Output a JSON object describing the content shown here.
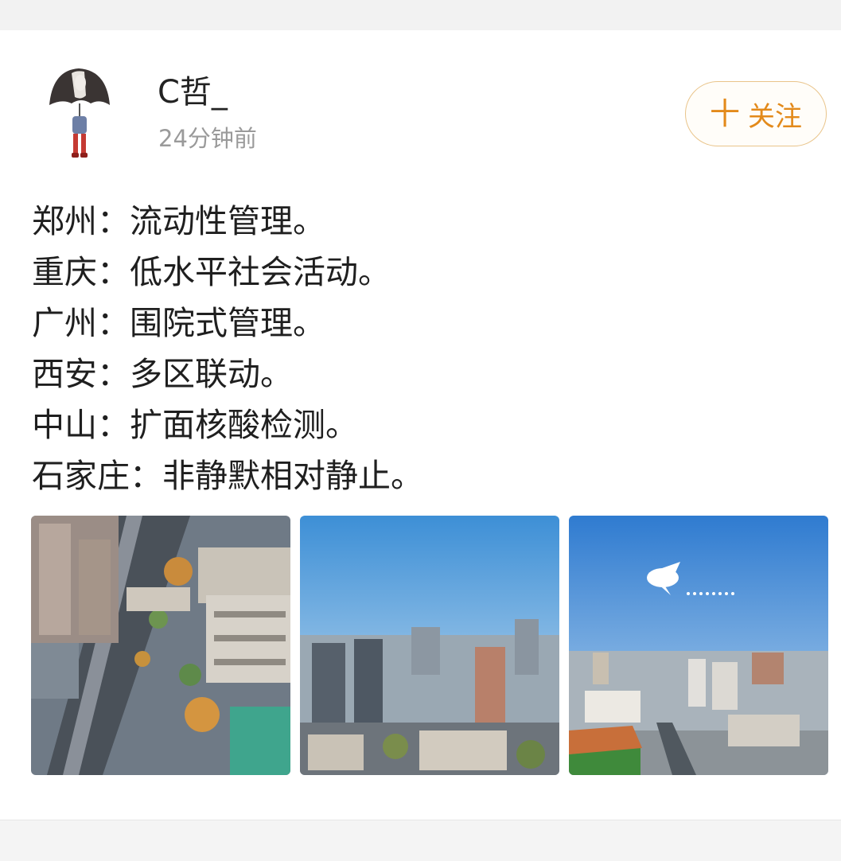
{
  "post": {
    "author": {
      "name": "C哲_",
      "time": "24分钟前"
    },
    "follow_button": {
      "plus": "十",
      "label": "关注"
    },
    "lines": [
      "郑州：流动性管理。",
      "重庆：低水平社会活动。",
      "广州：围院式管理。",
      "西安：多区联动。",
      "中山：扩面核酸检测。",
      "石家庄：非静默相对静止。"
    ],
    "photo_count": 3
  },
  "colors": {
    "accent": "#e38a1b",
    "follow_border": "#e9c48a",
    "text": "#1f1f1f",
    "muted": "#9a9a9a"
  }
}
